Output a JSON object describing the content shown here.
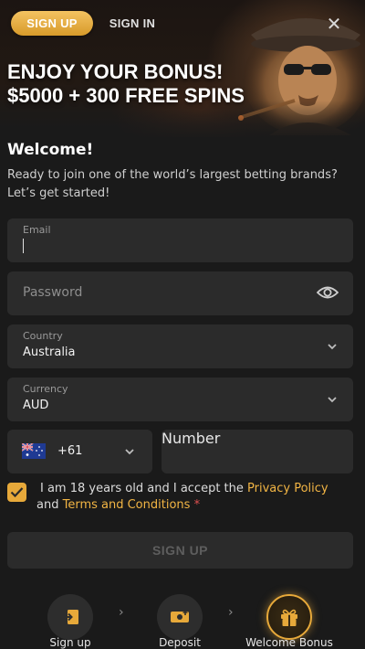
{
  "header": {
    "tab_signup": "SIGN UP",
    "tab_signin": "SIGN IN",
    "close_icon": "close-icon"
  },
  "promo": {
    "line1": "ENJOY YOUR BONUS!",
    "line2": "$5000 + 300 FREE SPINS"
  },
  "welcome": {
    "title": "Welcome!",
    "text": "Ready to join one of the world’s largest betting brands? Let’s get started!"
  },
  "form": {
    "email": {
      "label": "Email",
      "value": ""
    },
    "password": {
      "placeholder": "Password",
      "icon": "eye-icon"
    },
    "country": {
      "label": "Country",
      "value": "Australia"
    },
    "currency": {
      "label": "Currency",
      "value": "AUD"
    },
    "phone": {
      "code": "+61",
      "placeholder": "Number",
      "flag": "australia-flag"
    },
    "terms": {
      "prefix": "I am 18 years old and I accept the ",
      "privacy": "Privacy Policy",
      "and": " and ",
      "terms_link": "Terms and Conditions",
      "required_mark": "*",
      "checked": true
    },
    "submit": "SIGN UP"
  },
  "steps": [
    {
      "label": "Sign up",
      "icon": "signup-icon"
    },
    {
      "label": "Deposit",
      "icon": "deposit-icon"
    },
    {
      "label": "Welcome Bonus",
      "icon": "gift-icon",
      "active": true
    }
  ],
  "colors": {
    "accent": "#e7a93a",
    "link": "#f2b544",
    "background": "#1a1a1a",
    "field": "#2b2b2b"
  }
}
